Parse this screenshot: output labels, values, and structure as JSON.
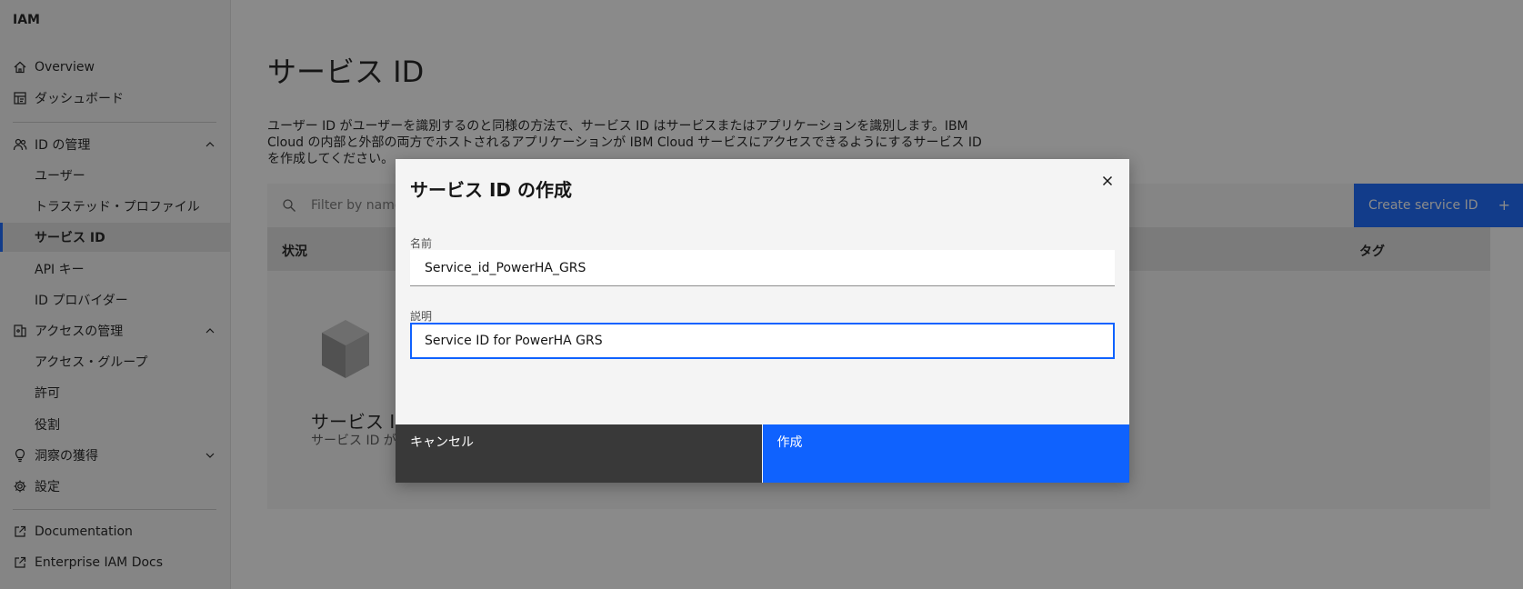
{
  "sidebar": {
    "title": "IAM",
    "items": [
      {
        "label": "Overview"
      },
      {
        "label": "ダッシュボード"
      },
      {
        "label": "ID の管理"
      },
      {
        "label": "ユーザー"
      },
      {
        "label": "トラステッド・プロファイル"
      },
      {
        "label": "サービス ID"
      },
      {
        "label": "API キー"
      },
      {
        "label": "ID プロバイダー"
      },
      {
        "label": "アクセスの管理"
      },
      {
        "label": "アクセス・グループ"
      },
      {
        "label": "許可"
      },
      {
        "label": "役割"
      },
      {
        "label": "洞察の獲得"
      },
      {
        "label": "設定"
      },
      {
        "label": "Documentation"
      },
      {
        "label": "Enterprise IAM Docs"
      }
    ],
    "active_index": 5
  },
  "main": {
    "title": "サービス ID",
    "description": "ユーザー ID がユーザーを識別するのと同様の方法で、サービス ID はサービスまたはアプリケーションを識別します。IBM Cloud の内部と外部の両方でホストされるアプリケーションが IBM Cloud サービスにアクセスできるようにするサービス ID を作成してください。",
    "search_placeholder": "Filter by name",
    "create_button": "Create service ID",
    "table_headers": {
      "status": "状況",
      "tags": "タグ"
    },
    "empty_title": "サービス I",
    "empty_subtitle": "サービス ID が"
  },
  "modal": {
    "title": "サービス ID の作成",
    "name_label": "名前",
    "name_value": "Service_id_PowerHA_GRS",
    "description_label": "説明",
    "description_value": "Service ID for PowerHA GRS",
    "cancel_label": "キャンセル",
    "create_label": "作成"
  },
  "colors": {
    "primary": "#0f62fe",
    "secondary_button": "#393939",
    "overlay": "rgba(22,22,22,0.5)"
  }
}
